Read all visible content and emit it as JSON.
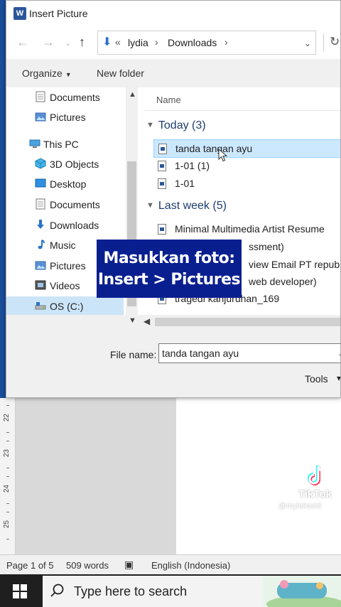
{
  "dialog": {
    "title": "Insert Picture",
    "app_icon": "word-icon"
  },
  "address_bar": {
    "overflow": "«",
    "crumbs": [
      "lydia",
      "Downloads"
    ]
  },
  "commands": {
    "organize": "Organize",
    "new_folder": "New folder"
  },
  "nav_pane": {
    "items": [
      {
        "label": "Documents",
        "icon": "document-icon"
      },
      {
        "label": "Pictures",
        "icon": "pictures-icon"
      },
      {
        "label": "This PC",
        "icon": "computer-icon"
      },
      {
        "label": "3D Objects",
        "icon": "cube-icon"
      },
      {
        "label": "Desktop",
        "icon": "desktop-icon"
      },
      {
        "label": "Documents",
        "icon": "document-icon"
      },
      {
        "label": "Downloads",
        "icon": "download-icon"
      },
      {
        "label": "Music",
        "icon": "music-icon"
      },
      {
        "label": "Pictures",
        "icon": "pictures-icon"
      },
      {
        "label": "Videos",
        "icon": "videos-icon"
      },
      {
        "label": "OS (C:)",
        "icon": "drive-icon",
        "selected": true
      }
    ]
  },
  "file_pane": {
    "column_header": "Name",
    "groups": [
      {
        "label": "Today (3)",
        "files": [
          "tanda tangan ayu",
          "1-01 (1)",
          "1-01"
        ]
      },
      {
        "label": "Last week (5)",
        "files": [
          "Minimal Multimedia Artist Resume",
          "ssment)",
          "view Email  PT republik",
          "web developer)",
          "tragedi kanjuruhan_169"
        ]
      }
    ],
    "selected_file": "tanda tangan ayu"
  },
  "footer": {
    "file_name_label": "File name:",
    "file_name_value": "tanda tangan ayu",
    "tools_label": "Tools"
  },
  "overlay": {
    "line1": "Masukkan foto:",
    "line2": "Insert > Pictures"
  },
  "ruler": {
    "numbers": [
      "22",
      "23",
      "24",
      "25"
    ]
  },
  "watermark": {
    "brand": "TikTok",
    "user": "@mylokasid"
  },
  "status_bar": {
    "page": "Page 1 of 5",
    "words": "509 words",
    "language": "English (Indonesia)"
  },
  "taskbar": {
    "search_placeholder": "Type here to search"
  },
  "colors": {
    "overlay_bg": "#0a1f8f",
    "selection": "#cce8ff",
    "word_blue": "#2b579a"
  }
}
